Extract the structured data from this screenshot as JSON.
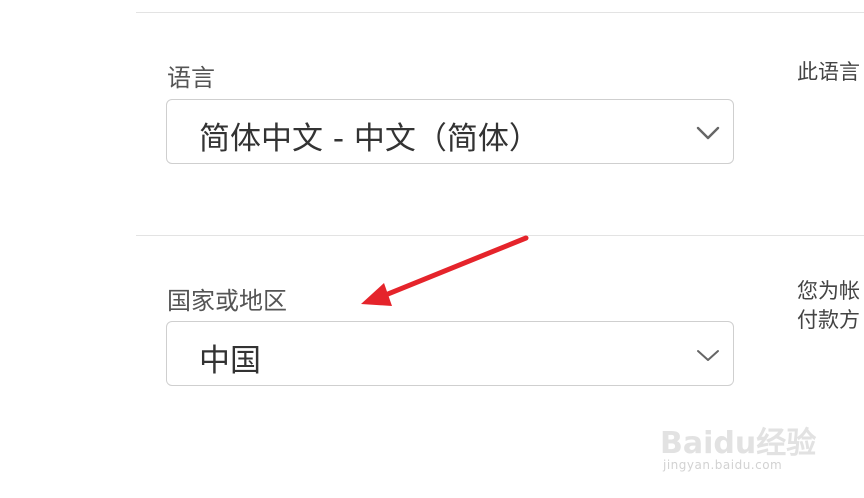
{
  "language": {
    "label": "语言",
    "selected": "简体中文 - 中文（简体）",
    "description": "此语言"
  },
  "region": {
    "label": "国家或地区",
    "selected": "中国",
    "description_line1": "您为帐",
    "description_line2": "付款方"
  },
  "watermark": {
    "brand": "Baidu经验",
    "url": "jingyan.baidu.com"
  },
  "colors": {
    "annotation_arrow": "#e5242b",
    "select_border": "#cfcfcf",
    "divider": "#e3e3e3"
  },
  "icons": {
    "select_indicator": "chevron-down-icon",
    "annotation": "arrow-annotation"
  }
}
